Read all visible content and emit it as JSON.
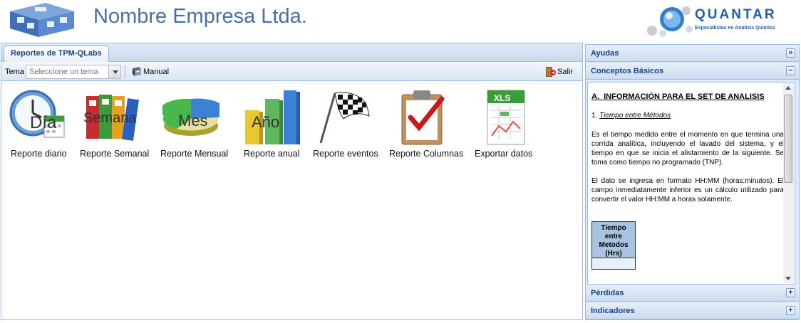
{
  "header": {
    "company_name": "Nombre Empresa Ltda.",
    "brand_name": "QUANTAR",
    "brand_tagline": "Especialistas en Análisis Químico"
  },
  "main": {
    "tab_label": "Reportes de TPM-QLabs",
    "toolbar": {
      "tema_label": "Tema",
      "tema_placeholder": "Seleccione un tema",
      "manual_label": "Manual",
      "salir_label": "Salir"
    },
    "reports": [
      {
        "label": "Reporte diario",
        "icon": "clock-calendar-icon",
        "overlay": "Día"
      },
      {
        "label": "Reporte Semanal",
        "icon": "binders-icon",
        "overlay": "Semana"
      },
      {
        "label": "Reporte Mensual",
        "icon": "pie-chart-icon",
        "overlay": "Mes"
      },
      {
        "label": "Reporte anual",
        "icon": "bar-chart-icon",
        "overlay": "Año"
      },
      {
        "label": "Reporte eventos",
        "icon": "checkered-flag-icon",
        "overlay": ""
      },
      {
        "label": "Reporte Columnas",
        "icon": "clipboard-check-icon",
        "overlay": ""
      },
      {
        "label": "Exportar datos",
        "icon": "excel-export-icon",
        "overlay": "XLS"
      }
    ]
  },
  "sidebar": {
    "panels": [
      {
        "title": "Ayudas",
        "tool": "»"
      },
      {
        "title": "Conceptos Básicos",
        "tool": "−"
      },
      {
        "title": "Pérdidas",
        "tool": "+"
      },
      {
        "title": "Indicadores",
        "tool": "+"
      }
    ],
    "content": {
      "section_letter": "A.",
      "section_title": "INFORMACIÓN PARA EL SET DE ANALISIS",
      "item_number": "1.",
      "item_title": "Tiempo entre Métodos",
      "paragraph1": "Es el tiempo medido entre el momento en que termina una corrida analítica, incluyendo el lavado del sistema, y el tiempo en que se inicia el alistamiento de la siguiente. Se toma como tiempo no programado (TNP).",
      "paragraph2": "El dato se ingresa en formato HH:MM (horas:minutos). El campo inmediatamente inferior es un cálculo utilizado para convertir el valor HH:MM a horas solamente.",
      "table_header": "Tiempo entre Metodos (Hrs)"
    }
  },
  "colors": {
    "header_text": "#4a6fa5",
    "panel_title": "#15428b",
    "panel_border": "#99bbe8",
    "panel_bg": "#dfe8f6"
  }
}
